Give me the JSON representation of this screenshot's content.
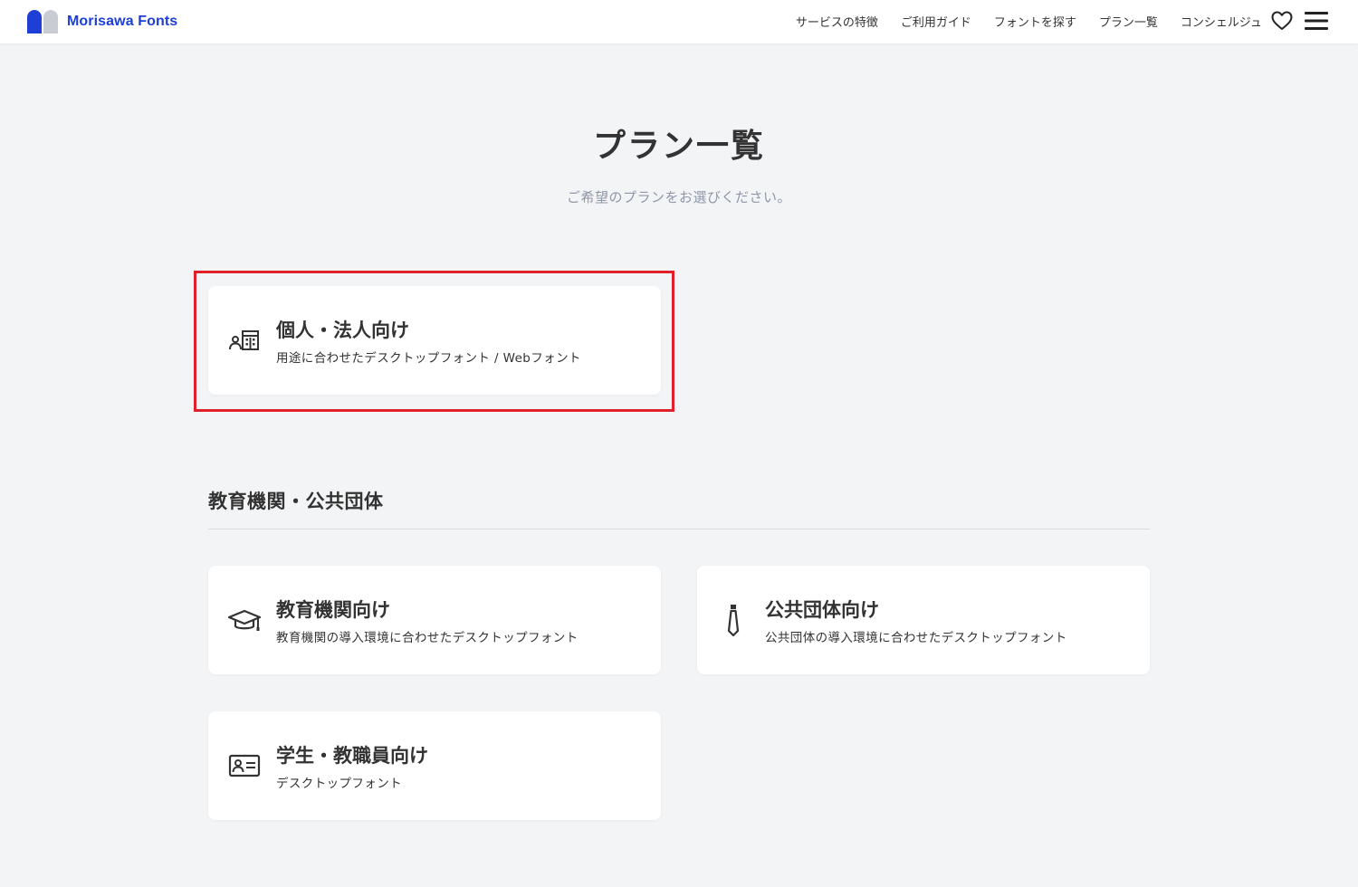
{
  "header": {
    "brand": "Morisawa Fonts",
    "brand_color": "#1d3fd6",
    "nav": [
      {
        "label": "サービスの特徴"
      },
      {
        "label": "ご利用ガイド"
      },
      {
        "label": "フォントを探す"
      },
      {
        "label": "プラン一覧"
      },
      {
        "label": "コンシェルジュ"
      }
    ],
    "icons": [
      "heart-icon",
      "hamburger-menu-icon"
    ]
  },
  "page": {
    "title": "プラン一覧",
    "subtitle": "ご希望のプランをお選びください。"
  },
  "plans": {
    "business": {
      "title": "個人・法人向け",
      "desc": "用途に合わせたデスクトップフォント / Webフォント",
      "icon": "person-building-icon",
      "highlighted": true,
      "highlight_color": "#e0202a"
    }
  },
  "education_section": {
    "title": "教育機関・公共団体",
    "cards": [
      {
        "title": "教育機関向け",
        "desc": "教育機関の導入環境に合わせたデスクトップフォント",
        "icon": "graduation-cap-icon"
      },
      {
        "title": "公共団体向け",
        "desc": "公共団体の導入環境に合わせたデスクトップフォント",
        "icon": "tie-icon"
      },
      {
        "title": "学生・教職員向け",
        "desc": "デスクトップフォント",
        "icon": "id-card-icon"
      }
    ]
  }
}
